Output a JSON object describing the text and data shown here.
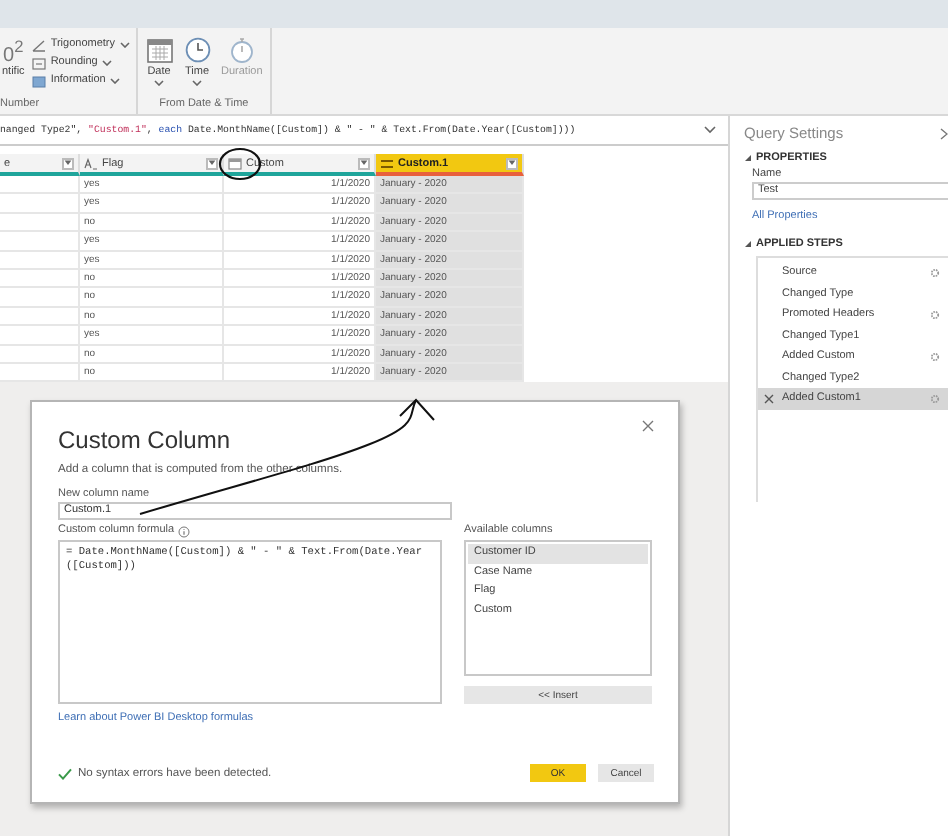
{
  "ribbon": {
    "groups": [
      {
        "label": "Number",
        "items": [
          {
            "kind": "large",
            "icon_text": "0$^{2}$",
            "label": "ntific",
            "dropdown": false,
            "disabled": false
          },
          {
            "kind": "small",
            "label": "Trigonometry",
            "dropdown": true,
            "disabled": false
          },
          {
            "kind": "small",
            "label": "Rounding",
            "dropdown": true,
            "disabled": false
          },
          {
            "kind": "small",
            "label": "Information",
            "dropdown": true,
            "disabled": false
          }
        ]
      },
      {
        "label": "From Date & Time",
        "items": [
          {
            "kind": "large",
            "label": "Date",
            "dropdown": true,
            "disabled": false
          },
          {
            "kind": "large",
            "label": "Time",
            "dropdown": true,
            "disabled": false
          },
          {
            "kind": "large",
            "label": "Duration",
            "dropdown": false,
            "disabled": true
          }
        ]
      }
    ]
  },
  "formula_bar": {
    "tokens": [
      {
        "kind": "plain",
        "text": "nanged Type2\", "
      },
      {
        "kind": "string",
        "text": "\"Custom.1\""
      },
      {
        "kind": "plain",
        "text": ", "
      },
      {
        "kind": "keyword",
        "text": "each"
      },
      {
        "kind": "plain",
        "text": " Date.MonthName([Custom]) & \" - \" & Text.From(Date.Year([Custom])))"
      }
    ]
  },
  "table": {
    "columns": [
      {
        "label": "e",
        "kind": "none",
        "selected": false
      },
      {
        "label": "Flag",
        "kind": "text",
        "selected": false
      },
      {
        "label": "Custom",
        "kind": "date",
        "selected": false
      },
      {
        "label": "Custom.1",
        "kind": "any",
        "selected": true
      }
    ],
    "rows": [
      {
        "flag": "yes",
        "custom": "1/1/2020",
        "custom_1": "January - 2020"
      },
      {
        "flag": "yes",
        "custom": "1/1/2020",
        "custom_1": "January - 2020"
      },
      {
        "flag": "no",
        "custom": "1/1/2020",
        "custom_1": "January - 2020"
      },
      {
        "flag": "yes",
        "custom": "1/1/2020",
        "custom_1": "January - 2020"
      },
      {
        "flag": "yes",
        "custom": "1/1/2020",
        "custom_1": "January - 2020"
      },
      {
        "flag": "no",
        "custom": "1/1/2020",
        "custom_1": "January - 2020"
      },
      {
        "flag": "no",
        "custom": "1/1/2020",
        "custom_1": "January - 2020"
      },
      {
        "flag": "no",
        "custom": "1/1/2020",
        "custom_1": "January - 2020"
      },
      {
        "flag": "yes",
        "custom": "1/1/2020",
        "custom_1": "January - 2020"
      },
      {
        "flag": "no",
        "custom": "1/1/2020",
        "custom_1": "January - 2020"
      },
      {
        "flag": "no",
        "custom": "1/1/2020",
        "custom_1": "January - 2020"
      }
    ]
  },
  "query_settings": {
    "title": "Query Settings",
    "properties": {
      "heading": "PROPERTIES",
      "name_label": "Name",
      "name_value": "Test",
      "link": "All Properties"
    },
    "applied_steps": {
      "heading": "APPLIED STEPS",
      "steps": [
        {
          "label": "Source",
          "has_settings": true,
          "selected": false
        },
        {
          "label": "Changed Type",
          "has_settings": false,
          "selected": false
        },
        {
          "label": "Promoted Headers",
          "has_settings": true,
          "selected": false
        },
        {
          "label": "Changed Type1",
          "has_settings": false,
          "selected": false
        },
        {
          "label": "Added Custom",
          "has_settings": true,
          "selected": false
        },
        {
          "label": "Changed Type2",
          "has_settings": false,
          "selected": false
        },
        {
          "label": "Added Custom1",
          "has_settings": true,
          "selected": true
        }
      ]
    }
  },
  "dialog": {
    "title": "Custom Column",
    "description": "Add a column that is computed from the other columns.",
    "name_label": "New column name",
    "name_value": "Custom.1",
    "formula_label": "Custom column formula",
    "formula_value": "= Date.MonthName([Custom]) & \" - \" & Text.From(Date.Year([Custom]))",
    "columns_label": "Available columns",
    "columns": [
      {
        "label": "Customer ID",
        "selected": true
      },
      {
        "label": "Case Name",
        "selected": false
      },
      {
        "label": "Flag",
        "selected": false
      },
      {
        "label": "Custom",
        "selected": false
      }
    ],
    "insert_button": "<< Insert",
    "link": "Learn about Power BI Desktop formulas",
    "status": {
      "ok": true,
      "text": "No syntax errors have been detected."
    },
    "buttons": [
      {
        "label": "OK",
        "primary": true
      },
      {
        "label": "Cancel",
        "primary": false
      }
    ]
  }
}
